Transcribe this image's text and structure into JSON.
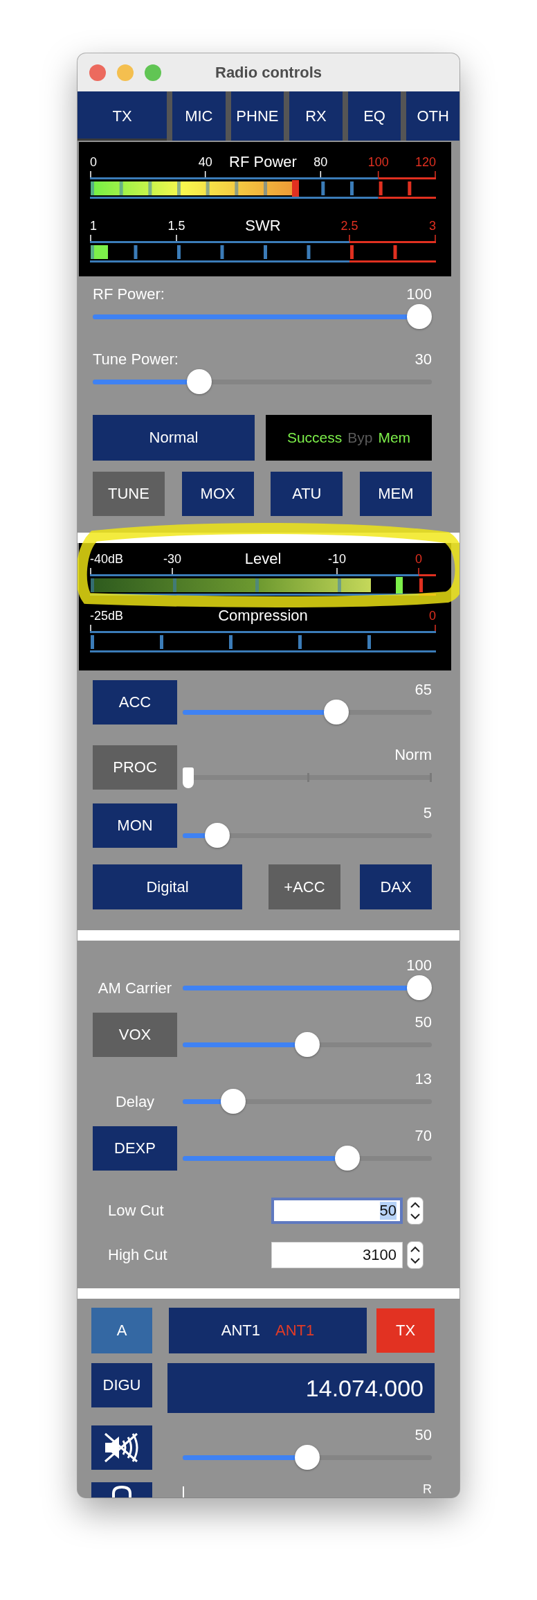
{
  "window": {
    "title": "Radio controls"
  },
  "tabs": [
    {
      "label": "TX",
      "selected": true
    },
    {
      "label": "MIC",
      "selected": false
    },
    {
      "label": "PHNE",
      "selected": false
    },
    {
      "label": "RX",
      "selected": false
    },
    {
      "label": "EQ",
      "selected": false
    },
    {
      "label": "OTH",
      "selected": false
    }
  ],
  "tx_meters": [
    {
      "kind": "power",
      "title": "RF Power",
      "scale": [
        {
          "label": "0",
          "danger": false
        },
        {
          "label": "40",
          "danger": false
        },
        {
          "label": "80",
          "danger": false
        },
        {
          "label": "100",
          "danger": true
        },
        {
          "label": "120",
          "danger": true
        }
      ],
      "level": 0.59,
      "peak": {
        "level": 0.59
      }
    },
    {
      "kind": "swr",
      "title": "SWR",
      "scale": [
        {
          "label": "1",
          "danger": false
        },
        {
          "label": "1.5",
          "danger": false
        },
        {
          "label": "2.5",
          "danger": true
        },
        {
          "label": "3",
          "danger": true
        }
      ],
      "level": 0.05
    }
  ],
  "tx_sliders": [
    {
      "label": "RF Power:",
      "value": "100",
      "level": 1
    },
    {
      "label": "Tune Power:",
      "value": "30",
      "level": 0.3
    }
  ],
  "mode_button": {
    "label": "Normal",
    "on": true
  },
  "atu_status": [
    {
      "text": "Success",
      "on": true
    },
    {
      "text": "Byp",
      "on": false
    },
    {
      "text": "Mem",
      "on": true
    }
  ],
  "tx_buttons": [
    {
      "label": "TUNE",
      "on": false
    },
    {
      "label": "MOX",
      "on": true
    },
    {
      "label": "ATU",
      "on": true
    },
    {
      "label": "MEM",
      "on": true
    }
  ],
  "mic_meters": [
    {
      "kind": "level",
      "title": "Level",
      "scale": [
        {
          "label": "-40dB",
          "danger": false
        },
        {
          "label": "-30",
          "danger": false
        },
        {
          "label": "-10",
          "danger": false
        },
        {
          "label": "0",
          "danger": true
        }
      ],
      "level": 0.81,
      "peak": {
        "level": 0.89
      },
      "highlight": true
    },
    {
      "kind": "compression",
      "title": "Compression",
      "scale": [
        {
          "label": "-25dB",
          "danger": false
        },
        {
          "label": "0",
          "danger": true
        }
      ]
    }
  ],
  "mic_rows": [
    {
      "kind": "button",
      "button": {
        "label": "ACC",
        "on": true
      },
      "value": "65",
      "level": 0.63
    },
    {
      "kind": "stepped",
      "button": {
        "label": "PROC",
        "on": false
      },
      "value": "Norm",
      "level": 0
    },
    {
      "kind": "button",
      "button": {
        "label": "MON",
        "on": true
      },
      "value": "5",
      "level": 0.1
    }
  ],
  "mic_buttons": [
    {
      "label": "Digital",
      "on": true
    },
    {
      "label": "+ACC",
      "on": false
    },
    {
      "label": "DAX",
      "on": true
    }
  ],
  "phone_rows": [
    {
      "kind": "label",
      "label": "AM Carrier",
      "value": "100",
      "level": 1
    },
    {
      "kind": "button",
      "button": {
        "label": "VOX",
        "on": false
      },
      "value": "50",
      "level": 0.5
    },
    {
      "kind": "label",
      "label": "Delay",
      "value": "13",
      "level": 0.17
    },
    {
      "kind": "button",
      "button": {
        "label": "DEXP",
        "on": true
      },
      "value": "70",
      "level": 0.68
    }
  ],
  "filters": [
    {
      "label": "Low Cut",
      "value": "50",
      "focused": true
    },
    {
      "label": "High Cut",
      "value": "3100",
      "focused": false
    }
  ],
  "slice": {
    "letter": "A",
    "rx_antenna": "ANT1",
    "tx_antenna": "ANT1",
    "tx_button": {
      "label": "TX",
      "on": true
    },
    "mode": "DIGU",
    "frequency": "14.074.000",
    "audio": {
      "muted": true,
      "value": "50",
      "level": 0.5
    },
    "pan": {
      "right_label": "R"
    }
  }
}
